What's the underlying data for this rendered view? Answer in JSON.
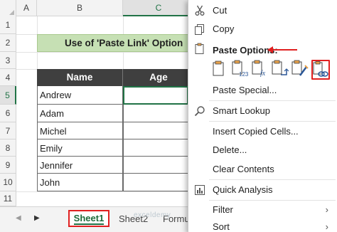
{
  "columns": [
    "A",
    "B",
    "C"
  ],
  "rows": [
    "1",
    "2",
    "3",
    "4",
    "5",
    "6",
    "7",
    "8",
    "9",
    "10",
    "11"
  ],
  "title": "Use of 'Paste Link' Option",
  "table": {
    "headers": [
      "Name",
      "Age"
    ],
    "names": [
      "Andrew",
      "Adam",
      "Michel",
      "Emily",
      "Jennifer",
      "John"
    ]
  },
  "sheet_tabs": {
    "active": "Sheet1",
    "others": [
      "Sheet2",
      "Formu"
    ]
  },
  "watermark": "exceldemy",
  "context_menu": {
    "cut": "Cut",
    "copy": "Copy",
    "paste_options": "Paste Options:",
    "paste_special": "Paste Special...",
    "smart_lookup": "Smart Lookup",
    "insert_copied_cells": "Insert Copied Cells...",
    "delete": "Delete...",
    "clear_contents": "Clear Contents",
    "quick_analysis": "Quick Analysis",
    "filter": "Filter",
    "sort": "Sort"
  },
  "paste_buttons": [
    {
      "icon": "paste-icon"
    },
    {
      "icon": "paste-values-icon"
    },
    {
      "icon": "paste-formulas-icon"
    },
    {
      "icon": "paste-transpose-icon"
    },
    {
      "icon": "paste-formatting-icon"
    },
    {
      "icon": "paste-link-icon",
      "highlighted": true
    }
  ],
  "colors": {
    "accent": "#217346",
    "highlight": "#e02020",
    "title_fill": "#c6e0b4",
    "header_fill": "#3f3f3f"
  }
}
